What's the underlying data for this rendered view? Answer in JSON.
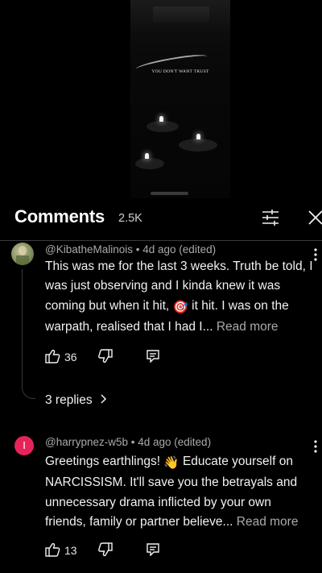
{
  "video": {
    "caption": "YOU DON'T WANT TRUST"
  },
  "header": {
    "title": "Comments",
    "count": "2.5K"
  },
  "comments": [
    {
      "author": "@KibatheMalinois",
      "time": "4d ago (edited)",
      "body_start": "This was me for the last 3 weeks. Truth be told, I was just observing and I kinda knew it was coming but when it hit, ",
      "emoji": "🎯",
      "body_end": " it hit. I was on the warpath, realised that I had I...",
      "read_more": "Read more",
      "likes": "36",
      "replies_label": "3 replies"
    },
    {
      "author": "@harrypnez-w5b",
      "time": "4d ago (edited)",
      "avatar_letter": "I",
      "body_start": "Greetings earthlings! ",
      "emoji": "👋",
      "body_end": " Educate yourself on NARCISSISM. It'll save you the betrayals and unnecessary drama inflicted by your own friends, family or partner believe...",
      "read_more": "Read more",
      "likes": "13"
    }
  ],
  "colors": {
    "background": "#000000",
    "text": "#f1f1f1",
    "meta": "#a9a9a9",
    "avatar2": "#e6245a"
  }
}
